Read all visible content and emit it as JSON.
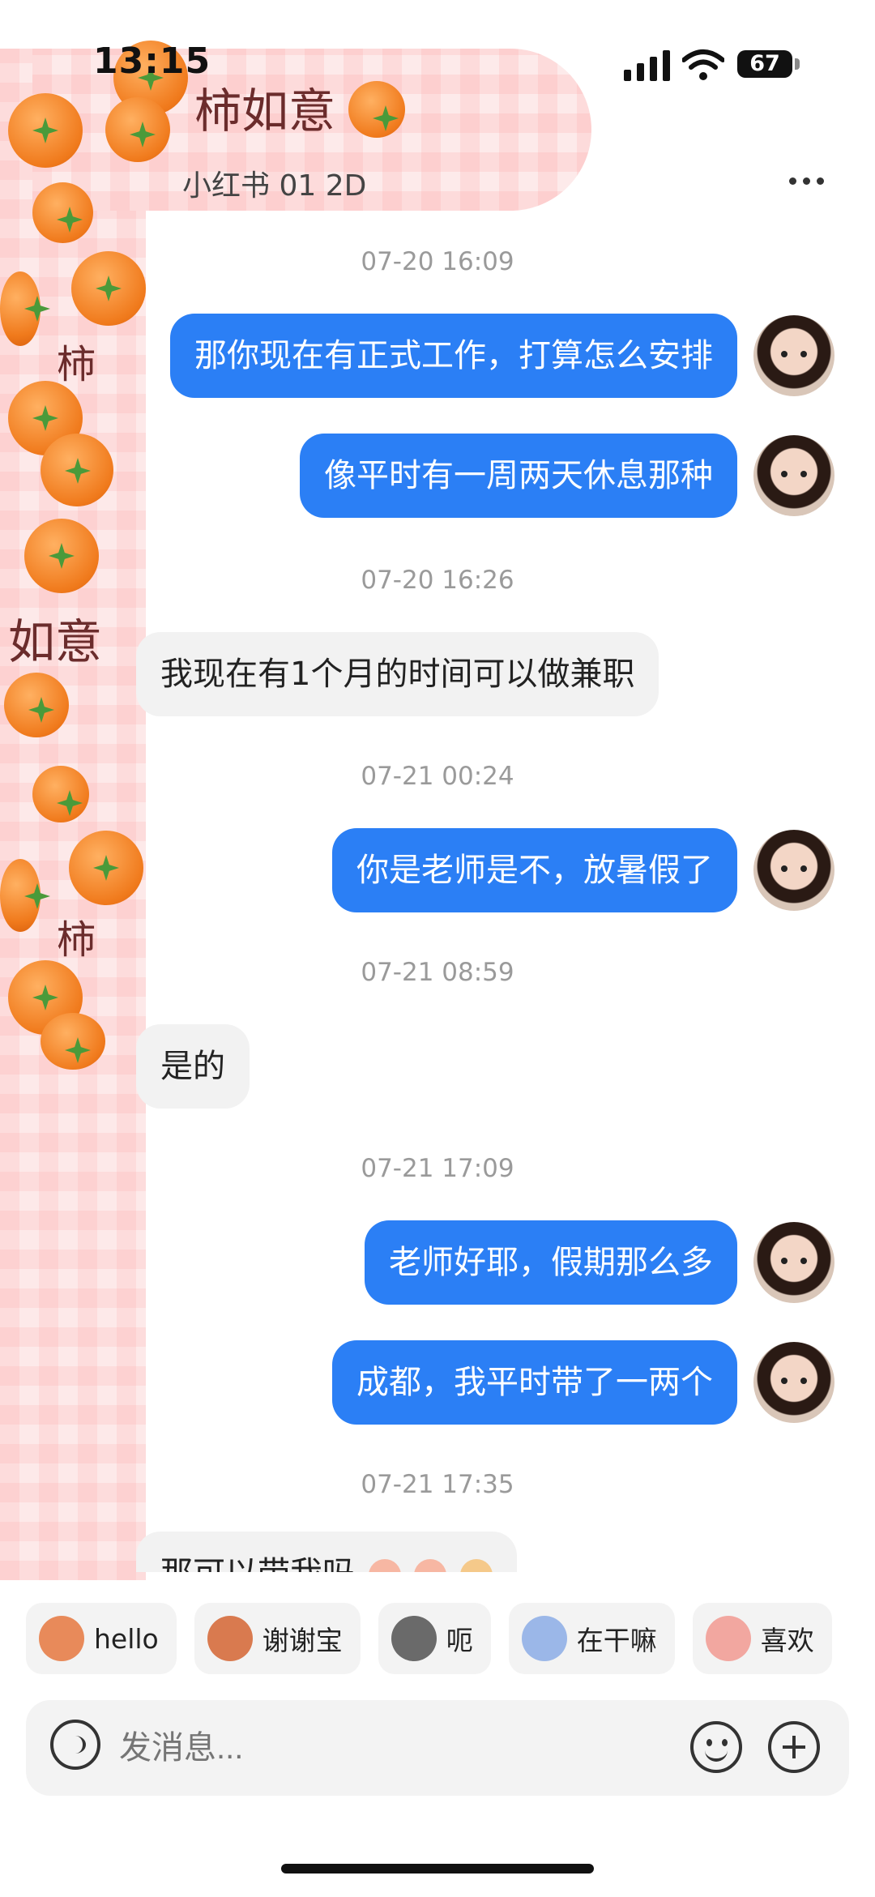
{
  "status_bar": {
    "time": "13:15",
    "battery": "67"
  },
  "header": {
    "title": "小红书 01 2D"
  },
  "decoration": {
    "phrase_1": "柿如意",
    "phrase_2": "如意",
    "phrase_3": "柿"
  },
  "messages": [
    {
      "type": "timestamp",
      "text": "07-20 16:09"
    },
    {
      "type": "out",
      "text": "那你现在有正式工作，打算怎么安排"
    },
    {
      "type": "out",
      "text": "像平时有一周两天休息那种"
    },
    {
      "type": "timestamp",
      "text": "07-20 16:26"
    },
    {
      "type": "in",
      "text": "我现在有1个月的时间可以做兼职"
    },
    {
      "type": "timestamp",
      "text": "07-21 00:24"
    },
    {
      "type": "out",
      "text": "你是老师是不，放暑假了"
    },
    {
      "type": "timestamp",
      "text": "07-21 08:59"
    },
    {
      "type": "in",
      "text": "是的"
    },
    {
      "type": "timestamp",
      "text": "07-21 17:09"
    },
    {
      "type": "out",
      "text": "老师好耶，假期那么多"
    },
    {
      "type": "out",
      "text": "成都，我平时带了一两个"
    },
    {
      "type": "timestamp",
      "text": "07-21 17:35"
    },
    {
      "type": "in",
      "text": "那可以带我吗"
    }
  ],
  "quick_replies": [
    {
      "label": "hello",
      "icon": "monkey-sticker-icon",
      "color": "#e88a5a"
    },
    {
      "label": "谢谢宝",
      "icon": "monkey-flower-sticker-icon",
      "color": "#d97a4f"
    },
    {
      "label": "呃",
      "icon": "cat-sticker-icon",
      "color": "#6a6a6a"
    },
    {
      "label": "在干嘛",
      "icon": "magnifier-sticker-icon",
      "color": "#9bb7e8"
    },
    {
      "label": "喜欢",
      "icon": "pig-sticker-icon",
      "color": "#f2a7a0"
    }
  ],
  "composer": {
    "placeholder": "发消息..."
  },
  "colors": {
    "accent": "#2b7ff5",
    "incoming_bubble": "#f2f2f2"
  }
}
